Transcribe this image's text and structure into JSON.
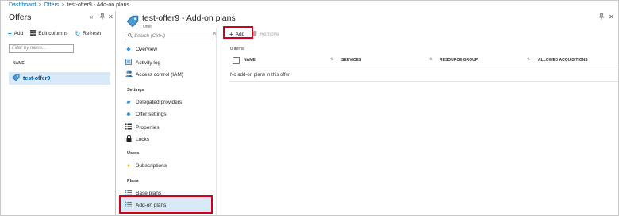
{
  "breadcrumb": {
    "items": [
      "Dashboard",
      "Offers",
      "test-offer9 - Add-on plans"
    ],
    "separator": ">"
  },
  "offers_blade": {
    "title": "Offers",
    "toolbar": {
      "add": "Add",
      "edit_columns": "Edit columns",
      "refresh": "Refresh"
    },
    "filter_placeholder": "Filter by name...",
    "column_header": "NAME",
    "rows": [
      "test-offer9"
    ]
  },
  "plans_blade": {
    "title": "test-offer9 - Add-on plans",
    "subtitle": "Offer",
    "search_placeholder": "Search (Ctrl+/)",
    "menu": {
      "top": [
        "Overview",
        "Activity log",
        "Access control (IAM)"
      ],
      "settings_header": "Settings",
      "settings": [
        "Delegated providers",
        "Offer settings",
        "Properties",
        "Locks"
      ],
      "users_header": "Users",
      "users": [
        "Subscriptions"
      ],
      "plans_header": "Plans",
      "plans": [
        "Base plans",
        "Add-on plans"
      ]
    },
    "toolbar": {
      "add": "Add",
      "remove": "Remove"
    },
    "item_count": "0 items",
    "columns": [
      "NAME",
      "SERVICES",
      "RESOURCE GROUP",
      "ALLOWED ACQUISITIONS"
    ],
    "empty_message": "No add-on plans in this offer"
  },
  "colors": {
    "accent": "#0072c6",
    "selected_bg": "#d9e9f7",
    "highlight": "#d0021b"
  }
}
